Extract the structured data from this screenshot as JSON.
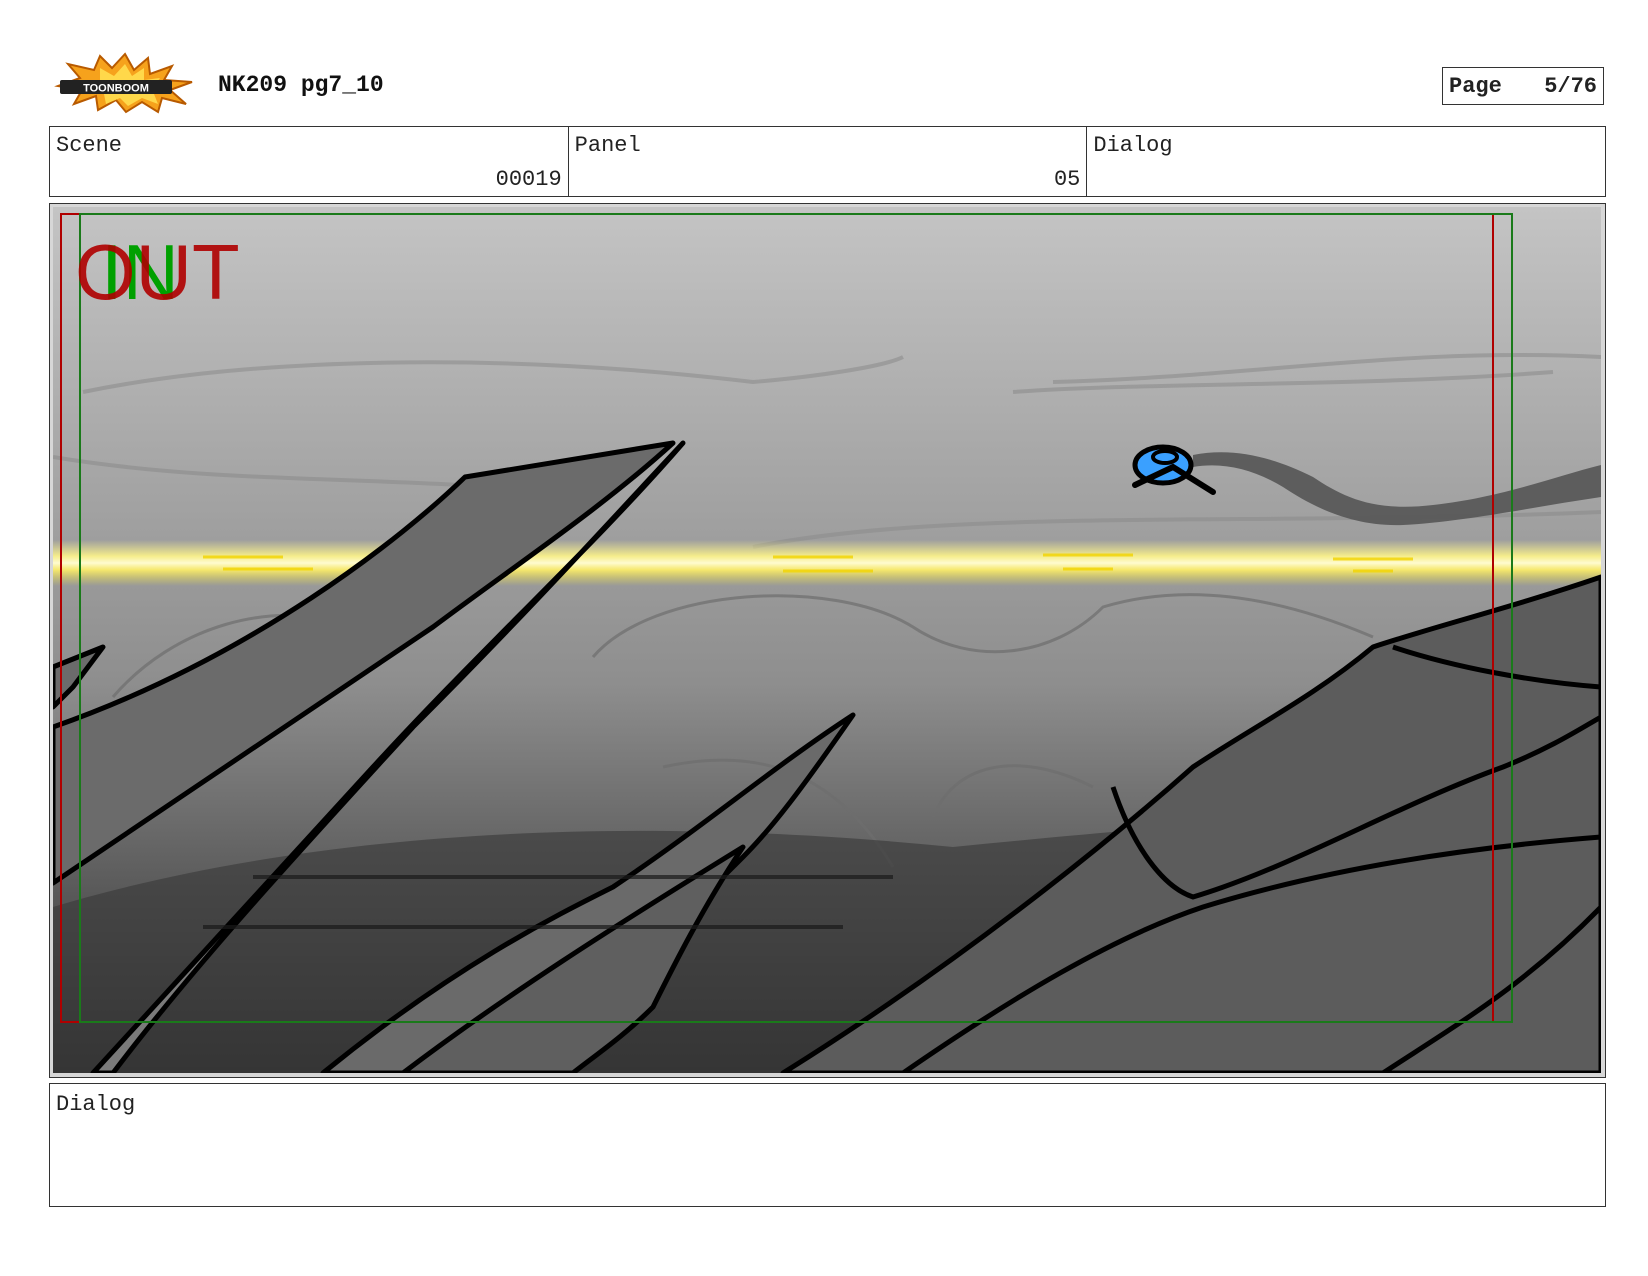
{
  "header": {
    "logo_text": "TOONBOOM",
    "title": "NK209 pg7_10",
    "page_label": "Page",
    "page_value": "5/76"
  },
  "info": {
    "scene_label": "Scene",
    "scene_value": "00019",
    "panel_label": "Panel",
    "panel_value": "05",
    "dialog_label": "Dialog"
  },
  "panel": {
    "out_marker": "OUT",
    "in_marker": "IN",
    "colors": {
      "out_marker": "#b00000",
      "in_marker": "#00a000",
      "laser_beam": "#fff68a",
      "ship": "#3aa0ff",
      "sky_top": "#bdbdbd",
      "ground": "#3a3a3a"
    }
  },
  "dialog": {
    "label": "Dialog"
  }
}
